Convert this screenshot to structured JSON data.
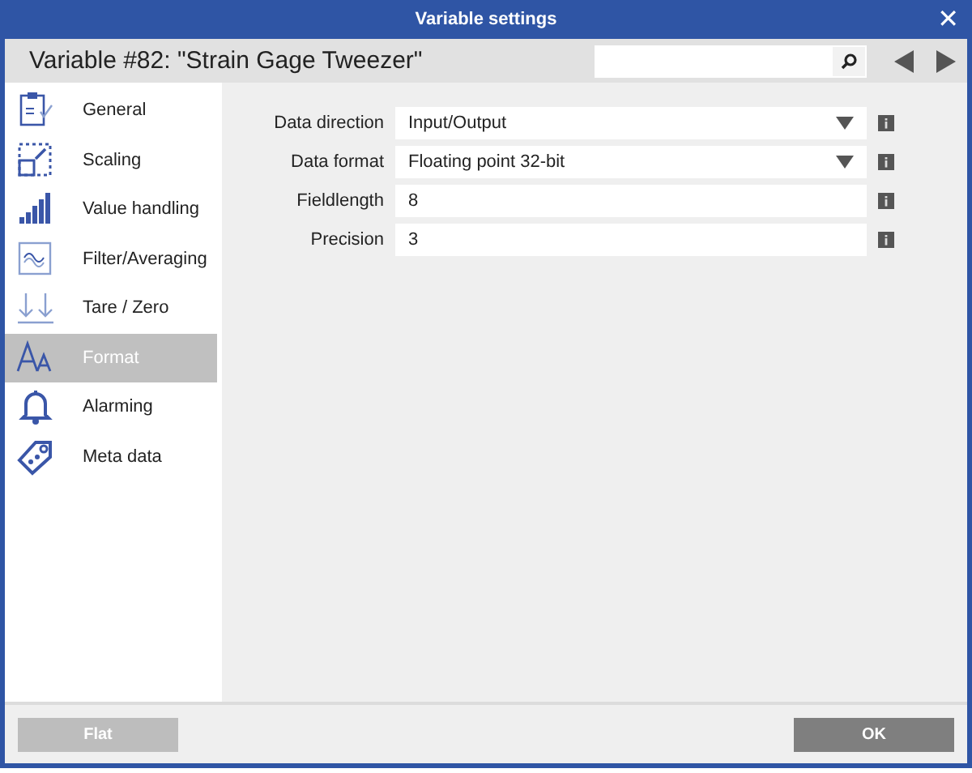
{
  "window": {
    "title": "Variable settings",
    "close": "✕"
  },
  "header": {
    "title": "Variable #82: \"Strain Gage Tweezer\""
  },
  "sidebar": {
    "items": [
      {
        "label": "General",
        "selected": false
      },
      {
        "label": "Scaling",
        "selected": false
      },
      {
        "label": "Value handling",
        "selected": false
      },
      {
        "label": "Filter/Averaging",
        "selected": false
      },
      {
        "label": "Tare / Zero",
        "selected": false
      },
      {
        "label": "Format",
        "selected": true
      },
      {
        "label": "Alarming",
        "selected": false
      },
      {
        "label": "Meta data",
        "selected": false
      }
    ]
  },
  "fields": [
    {
      "label": "Data direction",
      "kind": "dropdown",
      "value": "Input/Output"
    },
    {
      "label": "Data format",
      "kind": "dropdown",
      "value": "Floating point 32-bit"
    },
    {
      "label": "Fieldlength",
      "kind": "text",
      "value": "8"
    },
    {
      "label": "Precision",
      "kind": "text",
      "value": "3"
    }
  ],
  "buttons": [
    {
      "label": "Flat",
      "disabled": true
    },
    {
      "label": "OK",
      "disabled": false
    }
  ]
}
